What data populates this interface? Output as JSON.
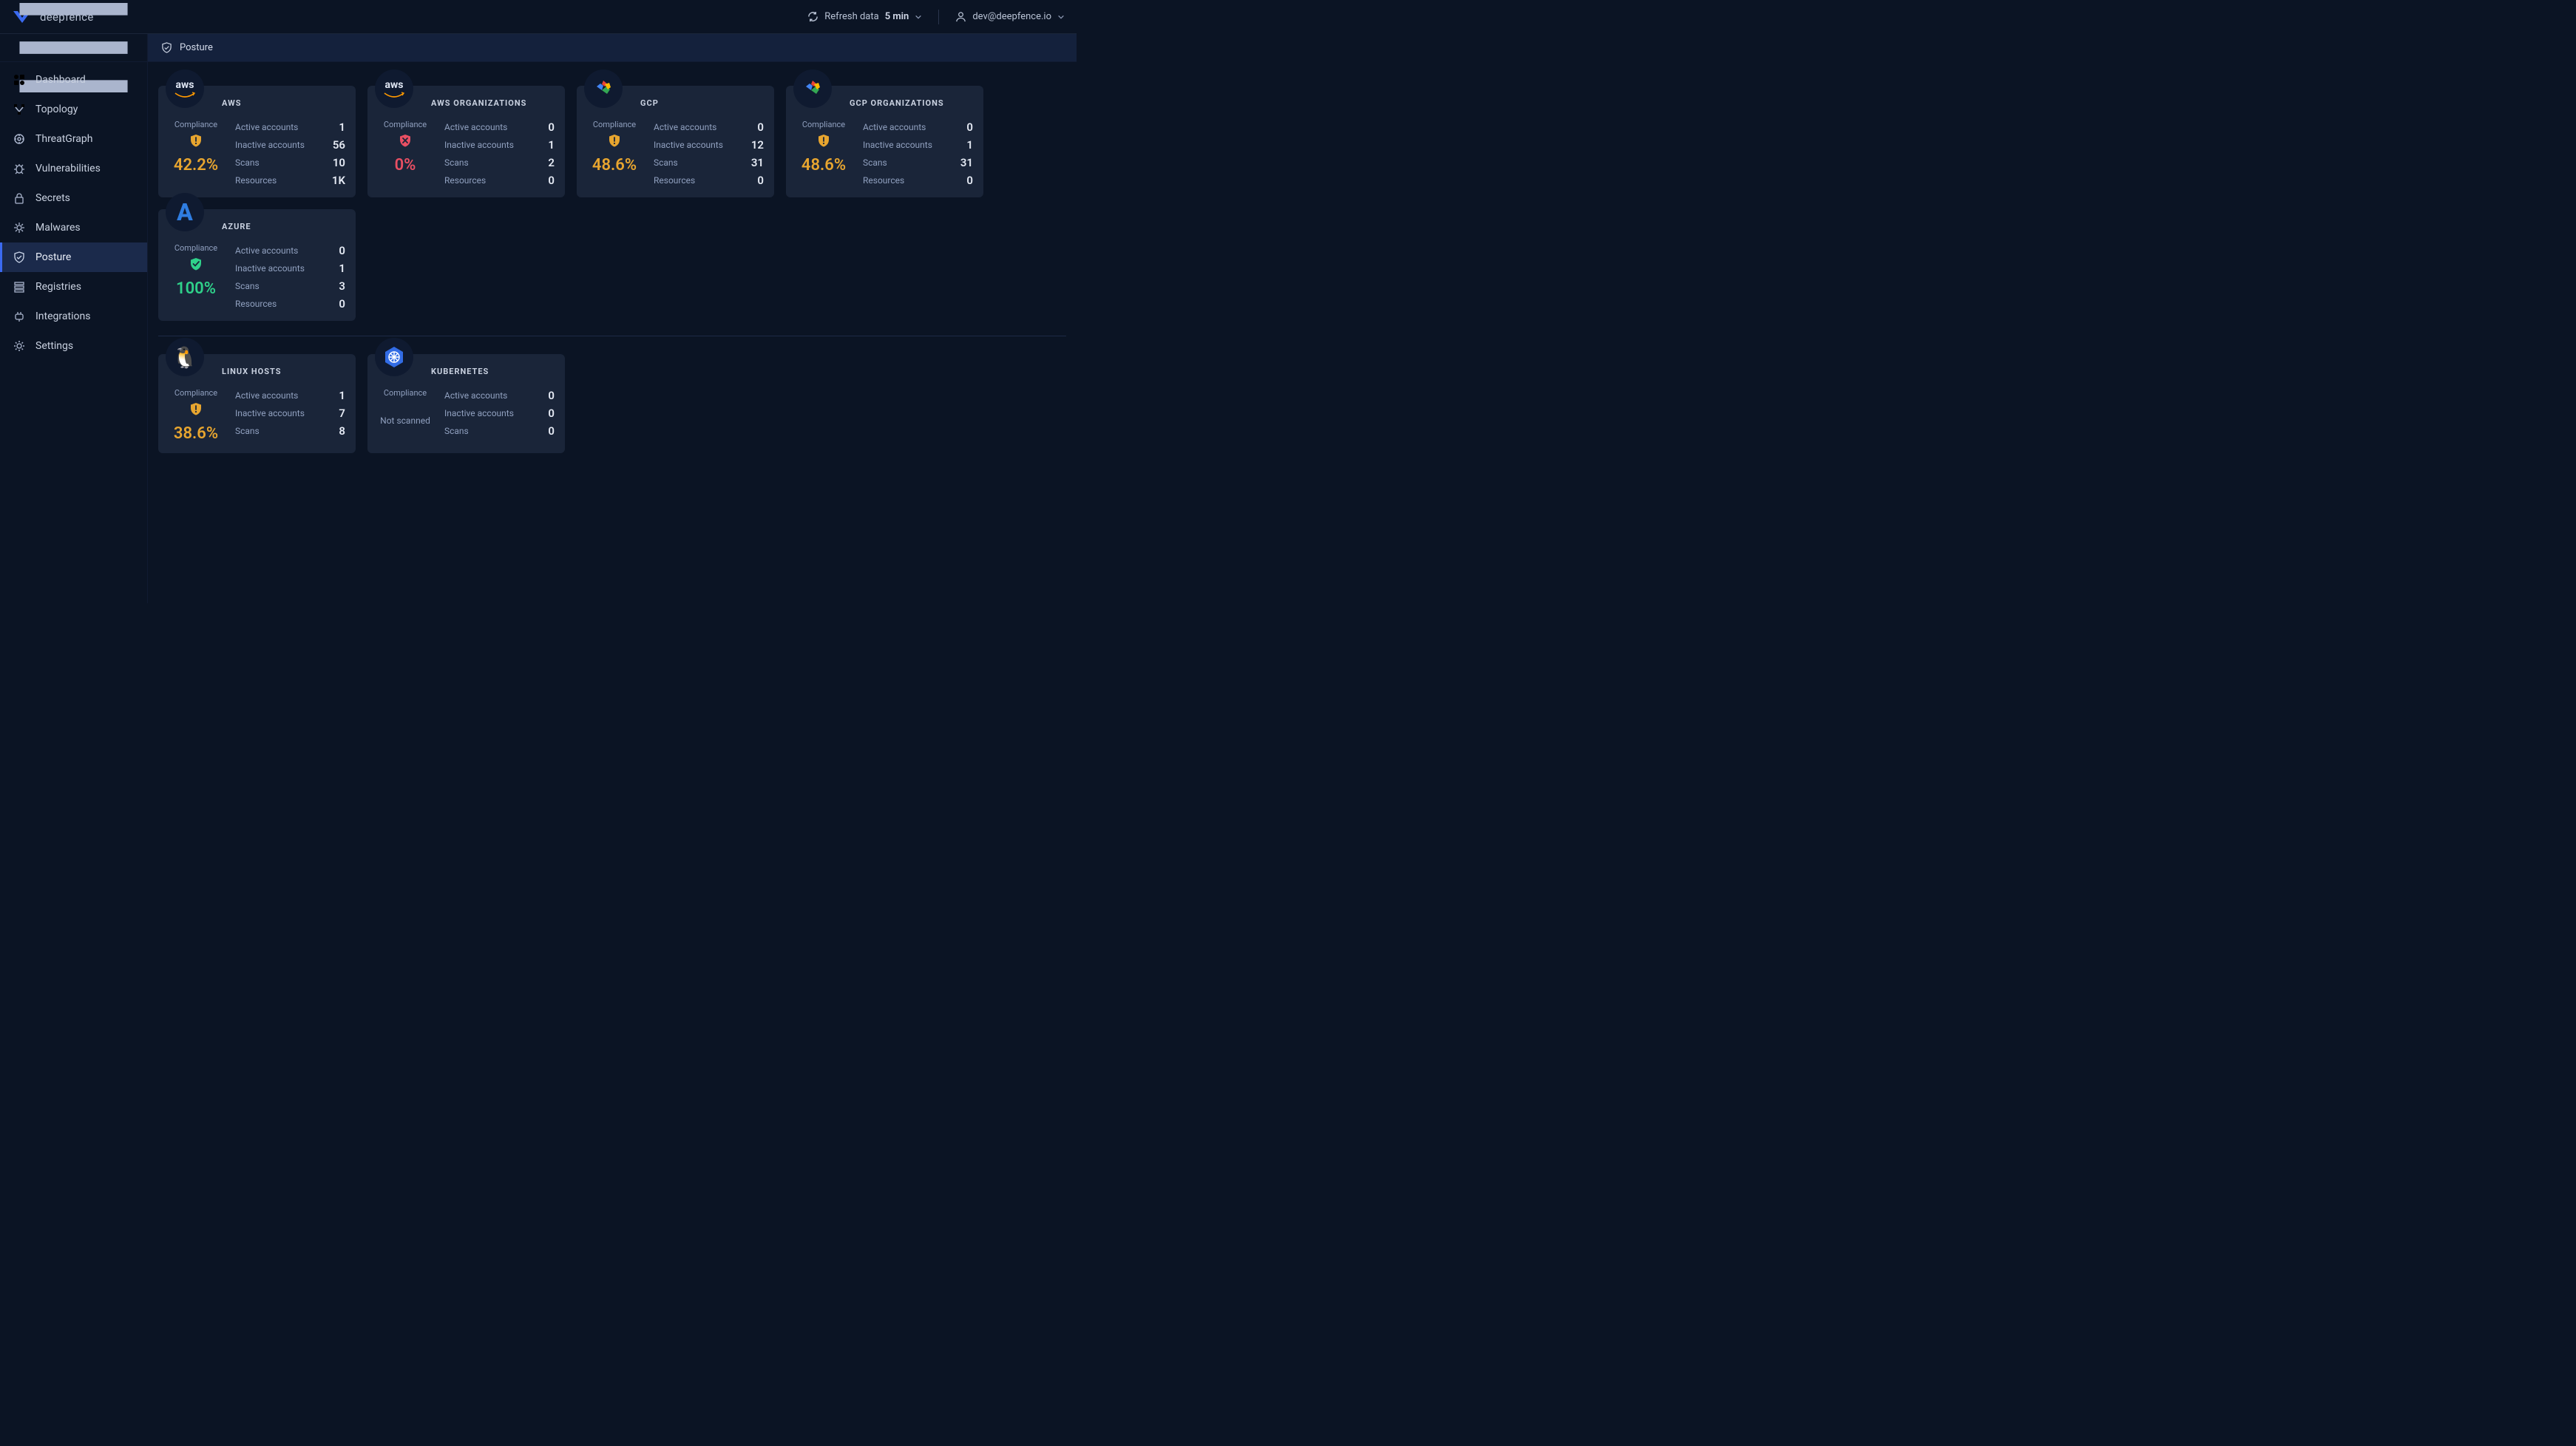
{
  "brand": "deepfence",
  "header": {
    "refresh_label": "Refresh data",
    "refresh_interval": "5 min",
    "user_email": "dev@deepfence.io"
  },
  "breadcrumb": {
    "title": "Posture"
  },
  "sidebar": {
    "items": [
      {
        "id": "dashboard",
        "label": "Dashboard",
        "active": false
      },
      {
        "id": "topology",
        "label": "Topology",
        "active": false
      },
      {
        "id": "threatgraph",
        "label": "ThreatGraph",
        "active": false
      },
      {
        "id": "vulnerabilities",
        "label": "Vulnerabilities",
        "active": false
      },
      {
        "id": "secrets",
        "label": "Secrets",
        "active": false
      },
      {
        "id": "malwares",
        "label": "Malwares",
        "active": false
      },
      {
        "id": "posture",
        "label": "Posture",
        "active": true
      },
      {
        "id": "registries",
        "label": "Registries",
        "active": false
      },
      {
        "id": "integrations",
        "label": "Integrations",
        "active": false
      },
      {
        "id": "settings",
        "label": "Settings",
        "active": false
      }
    ]
  },
  "labels": {
    "compliance": "Compliance",
    "not_scanned": "Not scanned",
    "stats": [
      "Active accounts",
      "Inactive accounts",
      "Scans",
      "Resources"
    ]
  },
  "colors": {
    "orange": "#e7a52f",
    "red": "#e94f63",
    "green": "#2fd18a",
    "accent": "#3b6af0"
  },
  "cards_top": [
    {
      "provider": "aws",
      "title": "AWS",
      "compliance_pct": "42.2%",
      "status": "orange",
      "stats": {
        "Active accounts": "1",
        "Inactive accounts": "56",
        "Scans": "10",
        "Resources": "1K"
      }
    },
    {
      "provider": "aws",
      "title": "AWS ORGANIZATIONS",
      "compliance_pct": "0%",
      "status": "red",
      "stats": {
        "Active accounts": "0",
        "Inactive accounts": "1",
        "Scans": "2",
        "Resources": "0"
      }
    },
    {
      "provider": "gcp",
      "title": "GCP",
      "compliance_pct": "48.6%",
      "status": "orange",
      "stats": {
        "Active accounts": "0",
        "Inactive accounts": "12",
        "Scans": "31",
        "Resources": "0"
      }
    },
    {
      "provider": "gcp",
      "title": "GCP ORGANIZATIONS",
      "compliance_pct": "48.6%",
      "status": "orange",
      "stats": {
        "Active accounts": "0",
        "Inactive accounts": "1",
        "Scans": "31",
        "Resources": "0"
      }
    },
    {
      "provider": "azure",
      "title": "AZURE",
      "compliance_pct": "100%",
      "status": "green",
      "stats": {
        "Active accounts": "0",
        "Inactive accounts": "1",
        "Scans": "3",
        "Resources": "0"
      }
    }
  ],
  "cards_bottom": [
    {
      "provider": "linux",
      "title": "LINUX HOSTS",
      "compliance_pct": "38.6%",
      "status": "orange",
      "stats": {
        "Active accounts": "1",
        "Inactive accounts": "7",
        "Scans": "8"
      }
    },
    {
      "provider": "kubernetes",
      "title": "KUBERNETES",
      "compliance_pct": null,
      "status": "notscanned",
      "stats": {
        "Active accounts": "0",
        "Inactive accounts": "0",
        "Scans": "0"
      }
    }
  ]
}
